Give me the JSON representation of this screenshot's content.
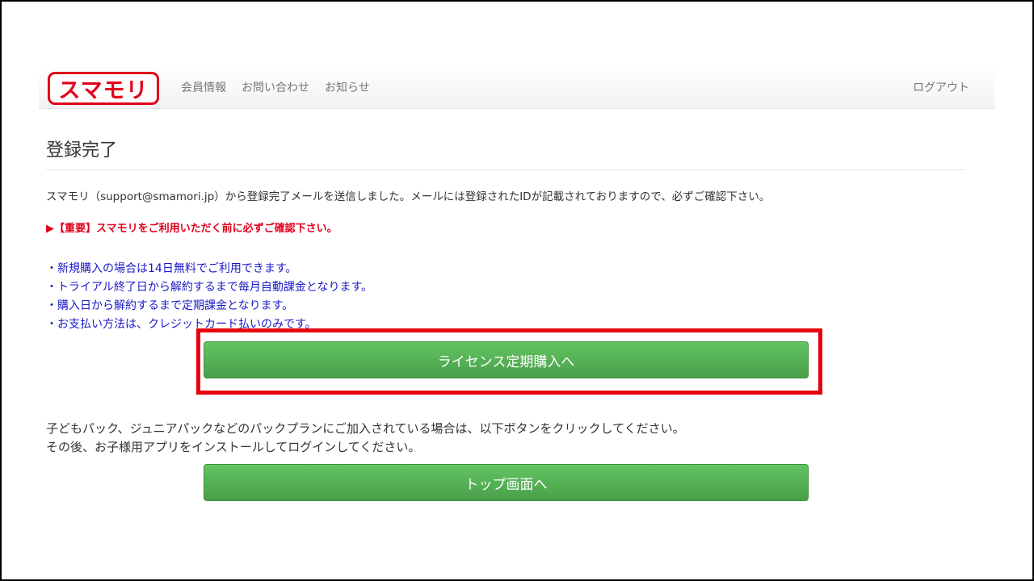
{
  "header": {
    "logo_text": "スマモリ",
    "nav": [
      "会員情報",
      "お問い合わせ",
      "お知らせ"
    ],
    "logout": "ログアウト"
  },
  "main": {
    "title": "登録完了",
    "message": "スマモリ（support@smamori.jp）から登録完了メールを送信しました。メールには登録されたIDが記載されておりますので、必ずご確認下さい。",
    "notice": "▶【重要】スマモリをご利用いただく前に必ずご確認下さい。",
    "bullets": [
      "・新規購入の場合は14日無料でご利用できます。",
      "・トライアル終了日から解約するまで毎月自動課金となります。",
      "・購入日から解約するまで定期課金となります。",
      "・お支払い方法は、クレジットカード払いのみです。"
    ],
    "purchase_button": "ライセンス定期購入へ",
    "pack_text_1": "子どもパック、ジュニアパックなどのパックプランにご加入されている場合は、以下ボタンをクリックしてください。",
    "pack_text_2": "その後、お子様用アプリをインストールしてログインしてください。",
    "top_button": "トップ画面へ"
  },
  "colors": {
    "brand_red": "#e1001a",
    "button_green": "#5cb85c",
    "bullet_blue": "#1a1ac8",
    "highlight_red": "#e8000d"
  }
}
